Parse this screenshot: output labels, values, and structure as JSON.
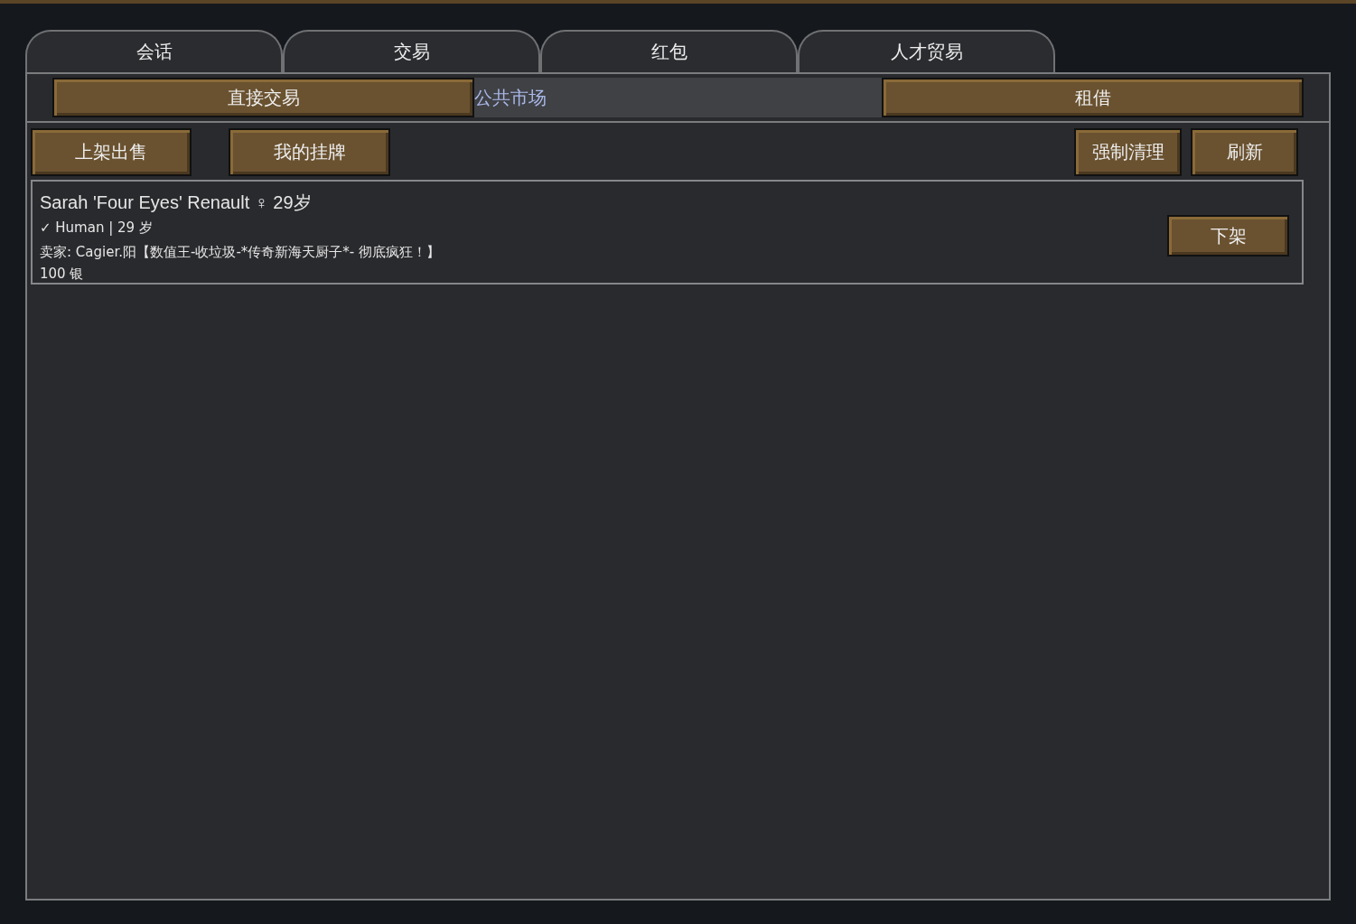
{
  "tabs": [
    {
      "label": "会话"
    },
    {
      "label": "交易"
    },
    {
      "label": "红包"
    },
    {
      "label": "人才贸易"
    }
  ],
  "subtabs": [
    {
      "label": "直接交易",
      "selected": false
    },
    {
      "label": "公共市场",
      "selected": true
    },
    {
      "label": "租借",
      "selected": false
    }
  ],
  "toolbar": {
    "left": [
      "上架出售",
      "我的挂牌"
    ],
    "right": [
      "强制清理",
      "刷新"
    ]
  },
  "listings": [
    {
      "name": "Sarah 'Four Eyes' Renault ♀ 29岁",
      "info": "✓ Human | 29 岁",
      "seller": "卖家: Cagier.阳【数值王-收垃圾-*传奇新海天厨子*- 彻底疯狂！】",
      "price": "100 银",
      "action": "下架"
    }
  ]
}
